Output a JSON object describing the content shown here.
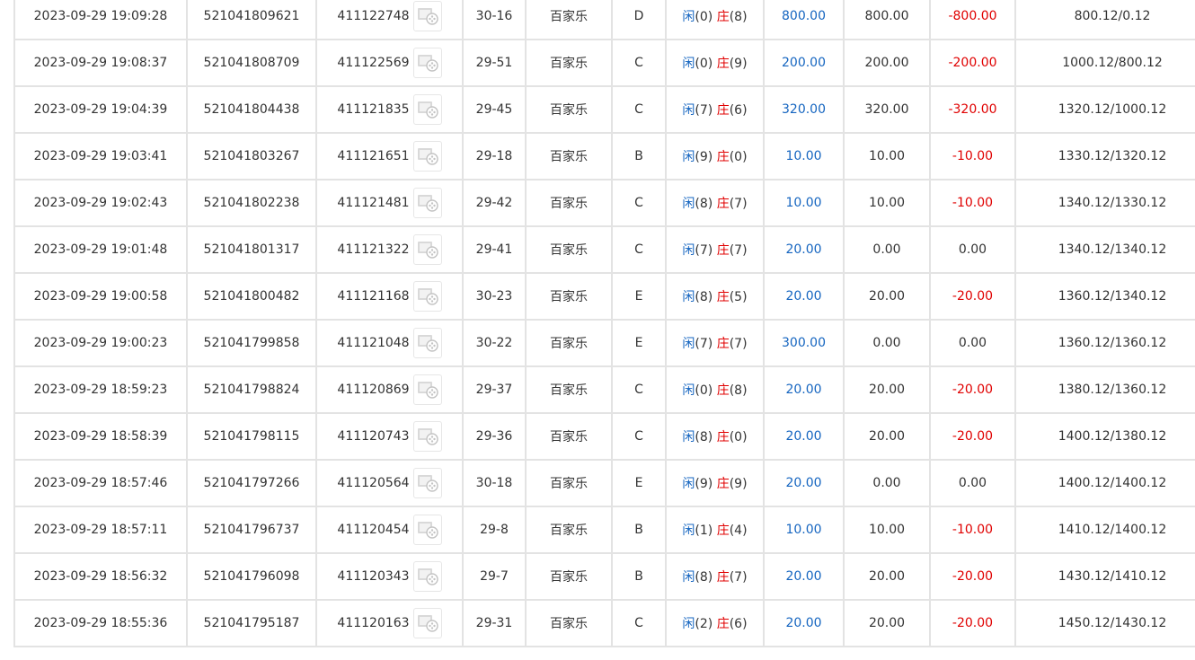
{
  "table": {
    "columns": [
      "time",
      "order_no",
      "round_no",
      "video",
      "shoe",
      "game",
      "table",
      "result",
      "bet",
      "valid_bet",
      "win_loss",
      "balance"
    ],
    "video_icon": "video-reel-icon",
    "result_labels": {
      "player": "闲",
      "banker": "庄"
    },
    "colors": {
      "bet": "#1565c0",
      "loss": "#e00000",
      "player_label": "#1565c0",
      "banker_label": "#e00000",
      "grid": "#e3e3e3"
    },
    "rows": [
      {
        "time": "2023-09-29 19:09:28",
        "order_no": "521041809621",
        "round_no": "411122748",
        "shoe": "30-16",
        "game": "百家乐",
        "table": "D",
        "player": "(0)",
        "banker": "(8)",
        "bet": "800.00",
        "valid_bet": "800.00",
        "win_loss": "-800.00",
        "balance": "800.12/0.12"
      },
      {
        "time": "2023-09-29 19:08:37",
        "order_no": "521041808709",
        "round_no": "411122569",
        "shoe": "29-51",
        "game": "百家乐",
        "table": "C",
        "player": "(0)",
        "banker": "(9)",
        "bet": "200.00",
        "valid_bet": "200.00",
        "win_loss": "-200.00",
        "balance": "1000.12/800.12"
      },
      {
        "time": "2023-09-29 19:04:39",
        "order_no": "521041804438",
        "round_no": "411121835",
        "shoe": "29-45",
        "game": "百家乐",
        "table": "C",
        "player": "(7)",
        "banker": "(6)",
        "bet": "320.00",
        "valid_bet": "320.00",
        "win_loss": "-320.00",
        "balance": "1320.12/1000.12"
      },
      {
        "time": "2023-09-29 19:03:41",
        "order_no": "521041803267",
        "round_no": "411121651",
        "shoe": "29-18",
        "game": "百家乐",
        "table": "B",
        "player": "(9)",
        "banker": "(0)",
        "bet": "10.00",
        "valid_bet": "10.00",
        "win_loss": "-10.00",
        "balance": "1330.12/1320.12"
      },
      {
        "time": "2023-09-29 19:02:43",
        "order_no": "521041802238",
        "round_no": "411121481",
        "shoe": "29-42",
        "game": "百家乐",
        "table": "C",
        "player": "(8)",
        "banker": "(7)",
        "bet": "10.00",
        "valid_bet": "10.00",
        "win_loss": "-10.00",
        "balance": "1340.12/1330.12"
      },
      {
        "time": "2023-09-29 19:01:48",
        "order_no": "521041801317",
        "round_no": "411121322",
        "shoe": "29-41",
        "game": "百家乐",
        "table": "C",
        "player": "(7)",
        "banker": "(7)",
        "bet": "20.00",
        "valid_bet": "0.00",
        "win_loss": "0.00",
        "balance": "1340.12/1340.12"
      },
      {
        "time": "2023-09-29 19:00:58",
        "order_no": "521041800482",
        "round_no": "411121168",
        "shoe": "30-23",
        "game": "百家乐",
        "table": "E",
        "player": "(8)",
        "banker": "(5)",
        "bet": "20.00",
        "valid_bet": "20.00",
        "win_loss": "-20.00",
        "balance": "1360.12/1340.12"
      },
      {
        "time": "2023-09-29 19:00:23",
        "order_no": "521041799858",
        "round_no": "411121048",
        "shoe": "30-22",
        "game": "百家乐",
        "table": "E",
        "player": "(7)",
        "banker": "(7)",
        "bet": "300.00",
        "valid_bet": "0.00",
        "win_loss": "0.00",
        "balance": "1360.12/1360.12"
      },
      {
        "time": "2023-09-29 18:59:23",
        "order_no": "521041798824",
        "round_no": "411120869",
        "shoe": "29-37",
        "game": "百家乐",
        "table": "C",
        "player": "(0)",
        "banker": "(8)",
        "bet": "20.00",
        "valid_bet": "20.00",
        "win_loss": "-20.00",
        "balance": "1380.12/1360.12"
      },
      {
        "time": "2023-09-29 18:58:39",
        "order_no": "521041798115",
        "round_no": "411120743",
        "shoe": "29-36",
        "game": "百家乐",
        "table": "C",
        "player": "(8)",
        "banker": "(0)",
        "bet": "20.00",
        "valid_bet": "20.00",
        "win_loss": "-20.00",
        "balance": "1400.12/1380.12"
      },
      {
        "time": "2023-09-29 18:57:46",
        "order_no": "521041797266",
        "round_no": "411120564",
        "shoe": "30-18",
        "game": "百家乐",
        "table": "E",
        "player": "(9)",
        "banker": "(9)",
        "bet": "20.00",
        "valid_bet": "0.00",
        "win_loss": "0.00",
        "balance": "1400.12/1400.12"
      },
      {
        "time": "2023-09-29 18:57:11",
        "order_no": "521041796737",
        "round_no": "411120454",
        "shoe": "29-8",
        "game": "百家乐",
        "table": "B",
        "player": "(1)",
        "banker": "(4)",
        "bet": "10.00",
        "valid_bet": "10.00",
        "win_loss": "-10.00",
        "balance": "1410.12/1400.12"
      },
      {
        "time": "2023-09-29 18:56:32",
        "order_no": "521041796098",
        "round_no": "411120343",
        "shoe": "29-7",
        "game": "百家乐",
        "table": "B",
        "player": "(8)",
        "banker": "(7)",
        "bet": "20.00",
        "valid_bet": "20.00",
        "win_loss": "-20.00",
        "balance": "1430.12/1410.12"
      },
      {
        "time": "2023-09-29 18:55:36",
        "order_no": "521041795187",
        "round_no": "411120163",
        "shoe": "29-31",
        "game": "百家乐",
        "table": "C",
        "player": "(2)",
        "banker": "(6)",
        "bet": "20.00",
        "valid_bet": "20.00",
        "win_loss": "-20.00",
        "balance": "1450.12/1430.12"
      }
    ]
  }
}
